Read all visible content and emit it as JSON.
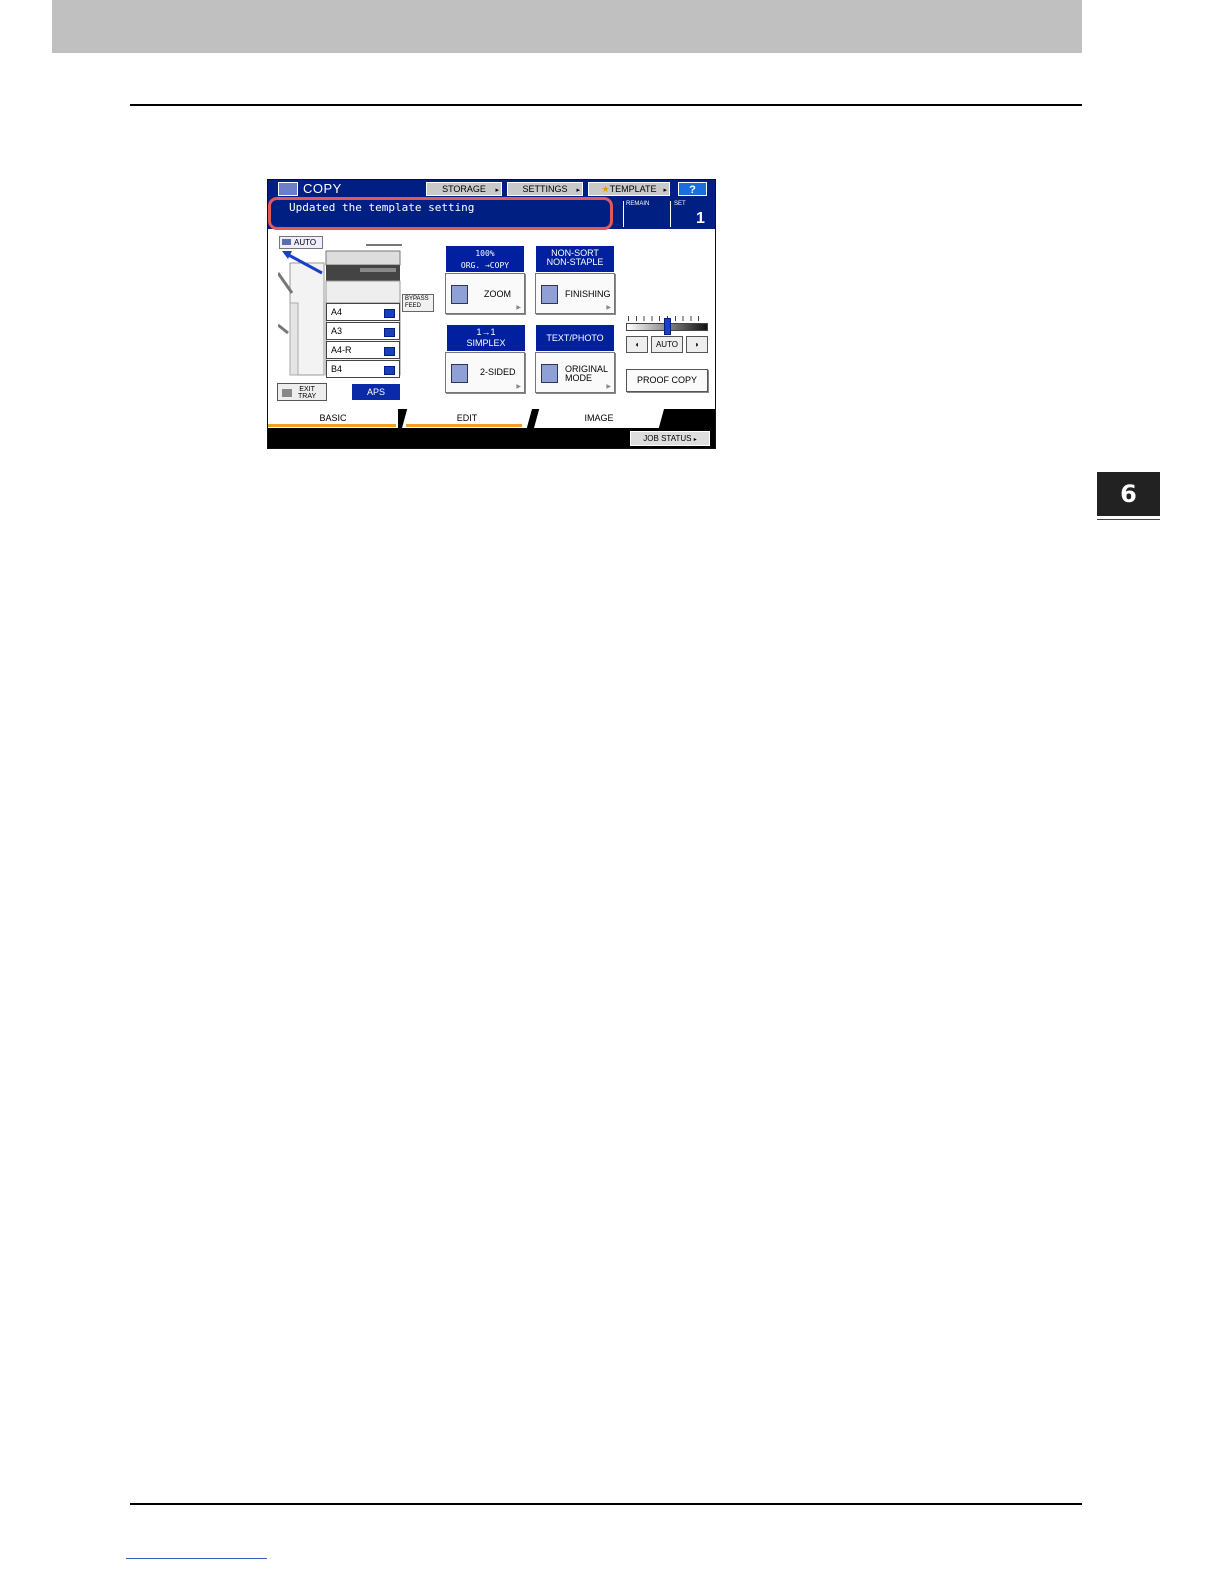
{
  "page": {
    "chapter_number": "6"
  },
  "screen": {
    "title": "COPY",
    "top_buttons": {
      "storage": "STORAGE",
      "settings": "SETTINGS",
      "template": "TEMPLATE",
      "help": "?"
    },
    "message": "Updated the template setting",
    "remain_label": "REMAIN",
    "set_label": "SET",
    "set_value": "1",
    "auto_label": "AUTO",
    "bypass_label_1": "BYPASS",
    "bypass_label_2": "FEED",
    "trays": [
      "A4",
      "A3",
      "A4-R",
      "B4"
    ],
    "exit_tray_1": "EXIT",
    "exit_tray_2": "TRAY",
    "aps": "APS",
    "zoom": {
      "header_1": "100%",
      "header_2": "ORG. →COPY",
      "label": "ZOOM"
    },
    "finishing": {
      "header_1": "NON-SORT",
      "header_2": "NON-STAPLE",
      "label": "FINISHING"
    },
    "sided": {
      "header_1": "1→1",
      "header_2": "SIMPLEX",
      "label": "2-SIDED"
    },
    "original_mode": {
      "header": "TEXT/PHOTO",
      "label_1": "ORIGINAL",
      "label_2": "MODE"
    },
    "density_auto": "AUTO",
    "proof_copy": "PROOF COPY",
    "tabs": [
      "BASIC",
      "EDIT",
      "IMAGE"
    ],
    "job_status": "JOB STATUS"
  }
}
